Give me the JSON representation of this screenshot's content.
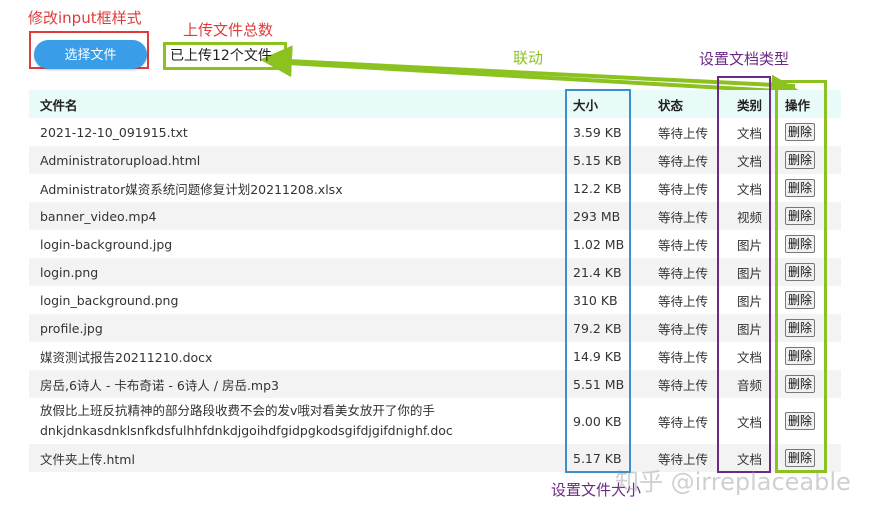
{
  "annotations": {
    "modify_input": "修改input框样式",
    "upload_total": "上传文件总数",
    "linkage": "联动",
    "set_doc_type": "设置文档类型",
    "set_file_size": "设置文件大小"
  },
  "uploader": {
    "choose_button": "选择文件",
    "uploaded_count": "已上传12个文件"
  },
  "table": {
    "headers": {
      "name": "文件名",
      "size": "大小",
      "status": "状态",
      "type": "类别",
      "action": "操作"
    },
    "rows": [
      {
        "name": "2021-12-10_091915.txt",
        "size": "3.59 KB",
        "status": "等待上传",
        "type": "文档",
        "action": "删除"
      },
      {
        "name": "Administratorupload.html",
        "size": "5.15 KB",
        "status": "等待上传",
        "type": "文档",
        "action": "删除"
      },
      {
        "name": "Administrator媒资系统问题修复计划20211208.xlsx",
        "size": "12.2 KB",
        "status": "等待上传",
        "type": "文档",
        "action": "删除"
      },
      {
        "name": "banner_video.mp4",
        "size": "293 MB",
        "status": "等待上传",
        "type": "视频",
        "action": "删除"
      },
      {
        "name": "login-background.jpg",
        "size": "1.02 MB",
        "status": "等待上传",
        "type": "图片",
        "action": "删除"
      },
      {
        "name": "login.png",
        "size": "21.4 KB",
        "status": "等待上传",
        "type": "图片",
        "action": "删除"
      },
      {
        "name": "login_background.png",
        "size": "310 KB",
        "status": "等待上传",
        "type": "图片",
        "action": "删除"
      },
      {
        "name": "profile.jpg",
        "size": "79.2 KB",
        "status": "等待上传",
        "type": "图片",
        "action": "删除"
      },
      {
        "name": "媒资测试报告20211210.docx",
        "size": "14.9 KB",
        "status": "等待上传",
        "type": "文档",
        "action": "删除"
      },
      {
        "name": "房岳,6诗人 - 卡布奇诺 - 6诗人 / 房岳.mp3",
        "size": "5.51 MB",
        "status": "等待上传",
        "type": "音频",
        "action": "删除"
      },
      {
        "name": "放假比上班反抗精神的部分路段收费不会的发v哦对看美女放开了你的手dnkjdnkasdnklsnfkdsfulhhfdnkdjgoihdfgidpgkodsgifdjgifdnighf.doc",
        "size": "9.00 KB",
        "status": "等待上传",
        "type": "文档",
        "action": "删除"
      },
      {
        "name": "文件夹上传.html",
        "size": "5.17 KB",
        "status": "等待上传",
        "type": "文档",
        "action": "删除"
      }
    ]
  },
  "watermark": "知乎 @irreplaceable",
  "colors": {
    "red": "#e03b3b",
    "green": "#8cc21f",
    "purple": "#6b2a86",
    "blue": "#3a8fcf",
    "button": "#3a9de8"
  }
}
